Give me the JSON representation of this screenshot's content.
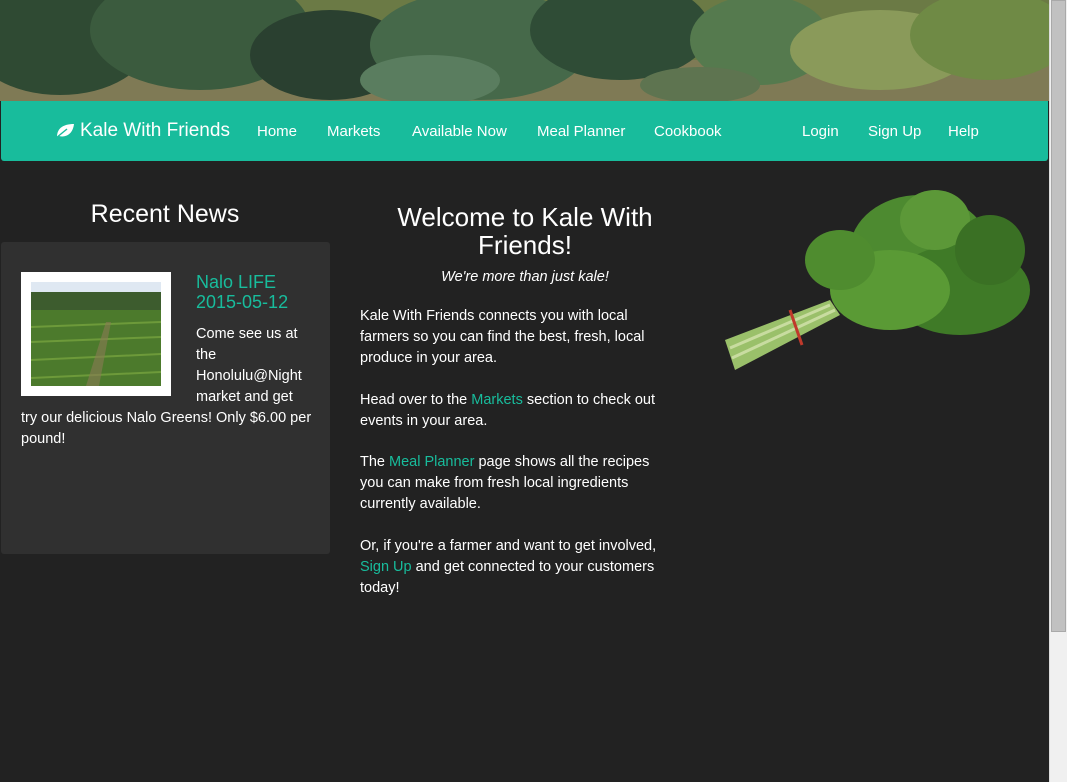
{
  "navbar": {
    "brand": "Kale With Friends",
    "links": [
      "Home",
      "Markets",
      "Available Now",
      "Meal Planner",
      "Cookbook"
    ],
    "right_links": [
      "Login",
      "Sign Up",
      "Help"
    ]
  },
  "news": {
    "title": "Recent News",
    "item": {
      "headline": "Nalo LIFE 2015-05-12",
      "body_start": "Come see us at the Honolulu@Night market and get",
      "body_end": "try our delicious Nalo Greens! Only $6.00 per pound!"
    }
  },
  "welcome": {
    "title": "Welcome to Kale With Friends!",
    "tagline": "We're more than just kale!",
    "p1": "Kale With Friends connects you with local farmers so you can find the best, fresh, local produce in your area.",
    "p2_before": "Head over to the ",
    "p2_link": "Markets",
    "p2_after": " section to check out events in your area.",
    "p3_before": "The ",
    "p3_link": "Meal Planner",
    "p3_after": " page shows all the recipes you can make from fresh local ingredients currently available.",
    "p4_before": "Or, if you're a farmer and want to get involved, ",
    "p4_link": "Sign Up",
    "p4_after": " and get connected to your customers today!"
  },
  "colors": {
    "accent": "#18bc9c",
    "background": "#222222",
    "panel": "#303030"
  },
  "icons": {
    "brand": "leaf-icon"
  }
}
